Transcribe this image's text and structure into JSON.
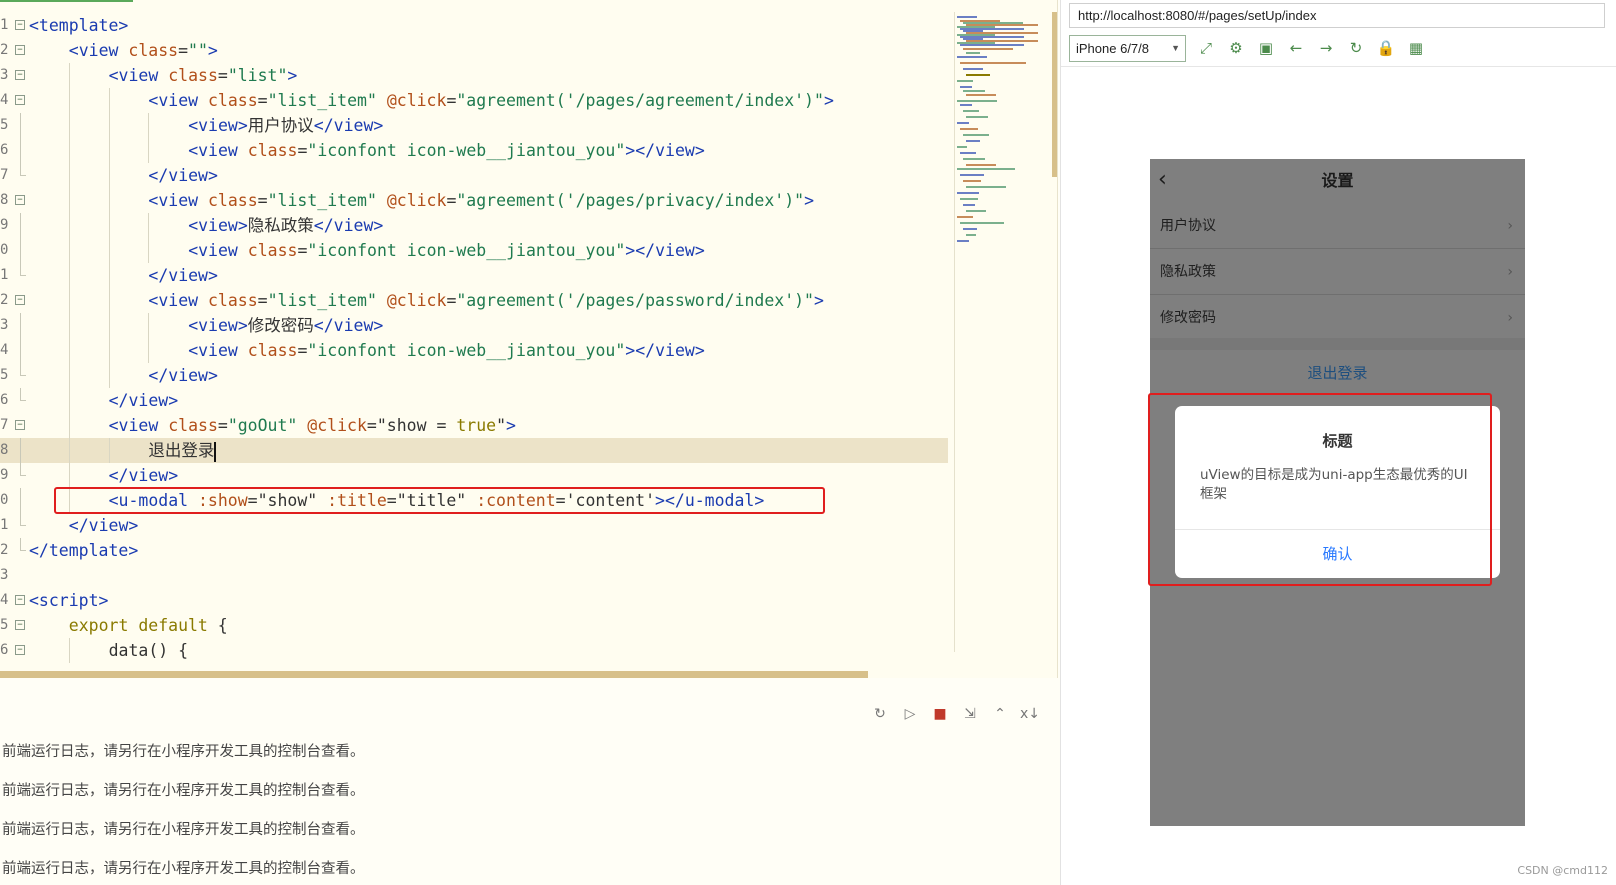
{
  "editor": {
    "lines": [
      {
        "num": "1",
        "fold": "⊟"
      },
      {
        "num": "2",
        "fold": "⊟"
      },
      {
        "num": "3",
        "fold": "⊟"
      },
      {
        "num": "4",
        "fold": "⊟"
      },
      {
        "num": "5",
        "fold": ""
      },
      {
        "num": "6",
        "fold": ""
      },
      {
        "num": "7",
        "fold": ""
      },
      {
        "num": "8",
        "fold": "⊟"
      },
      {
        "num": "9",
        "fold": ""
      },
      {
        "num": "0",
        "fold": ""
      },
      {
        "num": "1",
        "fold": ""
      },
      {
        "num": "2",
        "fold": "⊟"
      },
      {
        "num": "3",
        "fold": ""
      },
      {
        "num": "4",
        "fold": ""
      },
      {
        "num": "5",
        "fold": ""
      },
      {
        "num": "6",
        "fold": ""
      },
      {
        "num": "7",
        "fold": "⊟"
      },
      {
        "num": "8",
        "fold": ""
      },
      {
        "num": "9",
        "fold": ""
      },
      {
        "num": "0",
        "fold": ""
      },
      {
        "num": "1",
        "fold": ""
      },
      {
        "num": "2",
        "fold": ""
      },
      {
        "num": "3",
        "fold": ""
      },
      {
        "num": "4",
        "fold": "⊟"
      },
      {
        "num": "5",
        "fold": "⊟"
      },
      {
        "num": "6",
        "fold": "⊟"
      }
    ],
    "code": {
      "l1": {
        "a": "<template>"
      },
      "l2": {
        "a": "<view ",
        "b": "class",
        "c": "=",
        "d": "\"\"",
        "e": ">"
      },
      "l3": {
        "a": "<view ",
        "b": "class",
        "c": "=",
        "d": "\"list\"",
        "e": ">"
      },
      "l4": {
        "a": "<view ",
        "b": "class",
        "c": "=",
        "d": "\"list_item\"",
        "f": " @click",
        "g": "=",
        "h": "\"agreement('/pages/agreement/index')\"",
        "e": ">"
      },
      "l5": {
        "a": "<view>",
        "t": "用户协议",
        "z": "</view>"
      },
      "l6": {
        "a": "<view ",
        "b": "class",
        "c": "=",
        "d": "\"iconfont icon-web__jiantou_you\"",
        "e": "></view>"
      },
      "l7": {
        "a": "</view>"
      },
      "l8": {
        "a": "<view ",
        "b": "class",
        "c": "=",
        "d": "\"list_item\"",
        "f": " @click",
        "g": "=",
        "h": "\"agreement('/pages/privacy/index')\"",
        "e": ">"
      },
      "l9": {
        "a": "<view>",
        "t": "隐私政策",
        "z": "</view>"
      },
      "l10": {
        "a": "<view ",
        "b": "class",
        "c": "=",
        "d": "\"iconfont icon-web__jiantou_you\"",
        "e": "></view>"
      },
      "l11": {
        "a": "</view>"
      },
      "l12": {
        "a": "<view ",
        "b": "class",
        "c": "=",
        "d": "\"list_item\"",
        "f": " @click",
        "g": "=",
        "h": "\"agreement('/pages/password/index')\"",
        "e": ">"
      },
      "l13": {
        "a": "<view>",
        "t": "修改密码",
        "z": "</view>"
      },
      "l14": {
        "a": "<view ",
        "b": "class",
        "c": "=",
        "d": "\"iconfont icon-web__jiantou_you\"",
        "e": "></view>"
      },
      "l15": {
        "a": "</view>"
      },
      "l16": {
        "a": "</view>"
      },
      "l17": {
        "a": "<view ",
        "b": "class",
        "c": "=",
        "d": "\"goOut\"",
        "f": " @click",
        "g": "=",
        "h1": "\"show = ",
        "k": "true",
        "h2": "\"",
        "e": ">"
      },
      "l18": {
        "t": "退出登录"
      },
      "l19": {
        "a": "</view>"
      },
      "l20": {
        "a": "<u-modal ",
        "b1": ":show",
        "c1": "=",
        "d1": "\"show\" ",
        "b2": ":title",
        "c2": "=",
        "d2": "\"title\" ",
        "b3": ":content",
        "c3": "=",
        "d3": "'content'",
        "e": "></u-modal>"
      },
      "l21": {
        "a": "</view>"
      },
      "l22": {
        "a": "</template>"
      },
      "l23": {},
      "l24": {
        "a": "<script>"
      },
      "l25": {
        "k": "export default",
        "p": " {"
      },
      "l26": {
        "p": "data() {"
      }
    }
  },
  "console": {
    "toolbar": [
      "↻",
      "▷",
      "■",
      "⇲",
      "⌃",
      "x↓"
    ],
    "logs": [
      "前端运行日志，请另行在小程序开发工具的控制台查看。",
      "前端运行日志，请另行在小程序开发工具的控制台查看。",
      "前端运行日志，请另行在小程序开发工具的控制台查看。",
      "前端运行日志，请另行在小程序开发工具的控制台查看。"
    ]
  },
  "browser": {
    "url": "http://localhost:8080/#/pages/setUp/index",
    "device": "iPhone 6/7/8",
    "tools": [
      "⤢",
      "⚙",
      "▣",
      "←",
      "→",
      "↻",
      "🔒",
      "▦"
    ]
  },
  "phone": {
    "nav_back": "‹",
    "nav_title": "设置",
    "items": [
      {
        "label": "用户协议",
        "arrow": "›"
      },
      {
        "label": "隐私政策",
        "arrow": "›"
      },
      {
        "label": "修改密码",
        "arrow": "›"
      }
    ],
    "logout": "退出登录",
    "modal": {
      "title": "标题",
      "content": "uView的目标是成为uni-app生态最优秀的UI框架",
      "confirm": "确认"
    }
  },
  "watermark": "CSDN @cmd112"
}
